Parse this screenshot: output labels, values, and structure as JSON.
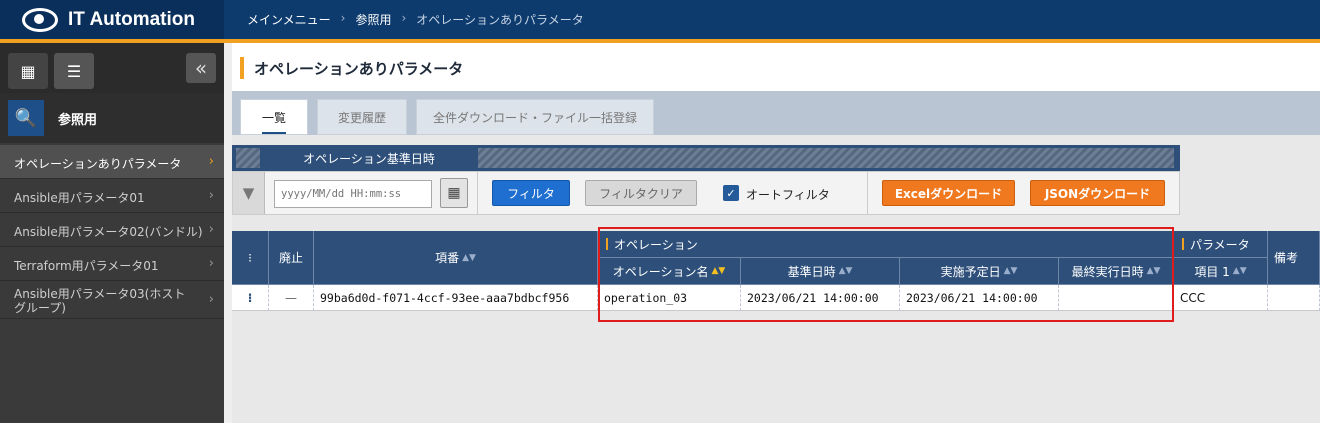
{
  "app": {
    "title": "IT Automation"
  },
  "breadcrumb": [
    "メインメニュー",
    "参照用",
    "オペレーションありパラメータ"
  ],
  "sidebar": {
    "group_label": "参照用",
    "items": [
      {
        "label": "オペレーションありパラメータ",
        "active": true
      },
      {
        "label": "Ansible用パラメータ01"
      },
      {
        "label": "Ansible用パラメータ02(バンドル)"
      },
      {
        "label": "Terraform用パラメータ01"
      },
      {
        "label": "Ansible用パラメータ03(ホストグループ)"
      }
    ]
  },
  "page": {
    "title": "オペレーションありパラメータ"
  },
  "tabs": [
    {
      "label": "一覧",
      "active": true
    },
    {
      "label": "変更履歴"
    },
    {
      "label": "全件ダウンロード・ファイル一括登録"
    }
  ],
  "filter": {
    "header_label": "オペレーション基準日時",
    "date_placeholder": "yyyy/MM/dd HH:mm:ss",
    "filter_button": "フィルタ",
    "clear_button": "フィルタクリア",
    "auto_filter_label": "オートフィルタ",
    "auto_filter_checked": true,
    "excel_button": "Excelダウンロード",
    "json_button": "JSONダウンロード"
  },
  "table": {
    "headers": {
      "menu": "⁝",
      "discard": "廃止",
      "item_no": "項番",
      "operation_group": "オペレーション",
      "operation_name": "オペレーション名",
      "base_datetime": "基準日時",
      "scheduled_date": "実施予定日",
      "last_exec_datetime": "最終実行日時",
      "parameter_group": "パラメータ",
      "item1": "項目 1",
      "remarks": "備考"
    },
    "rows": [
      {
        "menu": "⁝",
        "discard": "—",
        "item_no": "99ba6d0d-f071-4ccf-93ee-aaa7bdbcf956",
        "operation_name": "operation_03",
        "base_datetime": "2023/06/21 14:00:00",
        "scheduled_date": "2023/06/21 14:00:00",
        "last_exec_datetime": "",
        "item1": "CCC",
        "remarks": ""
      }
    ]
  },
  "colors": {
    "header": "#0e3b6e",
    "accent": "#f2a01f",
    "highlight": "#e01b1b"
  }
}
